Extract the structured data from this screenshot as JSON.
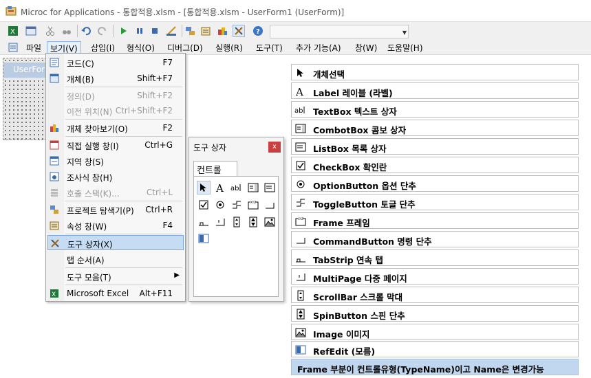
{
  "window": {
    "title": "Microc for Applications - 통합적용.xlsm - [통합적용.xlsm - UserForm1 (UserForm)]"
  },
  "toolbar": {
    "icons": [
      "excel-icon",
      "insert-userform-icon",
      "cut-icon",
      "find-icon",
      "undo-icon",
      "redo-icon",
      "run-icon",
      "break-icon",
      "reset-icon",
      "design-mode-icon",
      "project-explorer-icon",
      "properties-icon",
      "object-browser-icon",
      "toolbox-icon",
      "help-icon"
    ],
    "combo_value": ""
  },
  "menubar": {
    "items": [
      {
        "label": "파일"
      },
      {
        "label": "보기(V)"
      },
      {
        "label": "삽입(I)"
      },
      {
        "label": "형식(O)"
      },
      {
        "label": "디버그(D)"
      },
      {
        "label": "실행(R)"
      },
      {
        "label": "도구(T)"
      },
      {
        "label": "추가 기능(A)"
      },
      {
        "label": "창(W)"
      },
      {
        "label": "도움말(H)"
      }
    ]
  },
  "userform": {
    "title": "UserForm"
  },
  "view_menu": {
    "items": [
      {
        "label": "코드(C)",
        "shortcut": "F7",
        "icon": "code-icon",
        "enabled": true
      },
      {
        "label": "개체(B)",
        "shortcut": "Shift+F7",
        "icon": "object-icon",
        "enabled": true
      },
      {
        "label": "정의(D)",
        "shortcut": "Shift+F2",
        "icon": "",
        "enabled": false
      },
      {
        "label": "이전 위치(N)",
        "shortcut": "Ctrl+Shift+F2",
        "icon": "",
        "enabled": false
      },
      {
        "label": "개체 찾아보기(O)",
        "shortcut": "F2",
        "icon": "object-browser-icon",
        "enabled": true
      },
      {
        "label": "직접 실행 창(I)",
        "shortcut": "Ctrl+G",
        "icon": "immediate-window-icon",
        "enabled": true
      },
      {
        "label": "지역 창(S)",
        "shortcut": "",
        "icon": "locals-window-icon",
        "enabled": true
      },
      {
        "label": "조사식 창(H)",
        "shortcut": "",
        "icon": "watch-window-icon",
        "enabled": true
      },
      {
        "label": "호출 스택(K)...",
        "shortcut": "Ctrl+L",
        "icon": "call-stack-icon",
        "enabled": false
      },
      {
        "label": "프로젝트 탐색기(P)",
        "shortcut": "Ctrl+R",
        "icon": "project-explorer-icon",
        "enabled": true
      },
      {
        "label": "속성 창(W)",
        "shortcut": "F4",
        "icon": "properties-icon",
        "enabled": true
      },
      {
        "label": "도구 상자(X)",
        "shortcut": "",
        "icon": "toolbox-icon",
        "enabled": true
      },
      {
        "label": "탭 순서(A)",
        "shortcut": "",
        "icon": "",
        "enabled": true
      },
      {
        "label": "도구 모음(T)",
        "shortcut": "",
        "icon": "",
        "enabled": true
      },
      {
        "label": "Microsoft Excel",
        "shortcut": "Alt+F11",
        "icon": "excel-icon",
        "enabled": true
      }
    ]
  },
  "toolbox": {
    "title": "도구 상자",
    "close": "x",
    "tab": "컨트롤",
    "tools": [
      "select-objects-icon",
      "label-icon",
      "textbox-icon",
      "combobox-icon",
      "listbox-icon",
      "checkbox-icon",
      "optionbutton-icon",
      "togglebutton-icon",
      "frame-icon",
      "commandbutton-icon",
      "tabstrip-icon",
      "multipage-icon",
      "scrollbar-icon",
      "spinbutton-icon",
      "image-icon",
      "refedit-icon"
    ]
  },
  "control_list": [
    {
      "icon": "select-objects-icon",
      "text": "개체선택"
    },
    {
      "icon": "label-icon",
      "text": "Label 레이블 (라벨)"
    },
    {
      "icon": "textbox-icon",
      "text": "TextBox 텍스트 상자"
    },
    {
      "icon": "combobox-icon",
      "text": "CombotBox 콤보 상자"
    },
    {
      "icon": "listbox-icon",
      "text": "ListBox 목록 상자"
    },
    {
      "icon": "checkbox-icon",
      "text": "CheckBox 확인란"
    },
    {
      "icon": "optionbutton-icon",
      "text": "OptionButton 옵션 단추"
    },
    {
      "icon": "togglebutton-icon",
      "text": "ToggleButton 토글 단추"
    },
    {
      "icon": "frame-icon",
      "text": "Frame 프레임"
    },
    {
      "icon": "commandbutton-icon",
      "text": "CommandButton 명령 단추"
    },
    {
      "icon": "tabstrip-icon",
      "text": "TabStrip 연속 탭"
    },
    {
      "icon": "multipage-icon",
      "text": "MultiPage 다중 페이지"
    },
    {
      "icon": "scrollbar-icon",
      "text": "ScrollBar 스크롤 막대"
    },
    {
      "icon": "spinbutton-icon",
      "text": "SpinButton 스핀 단추"
    },
    {
      "icon": "image-icon",
      "text": "Image 이미지"
    },
    {
      "icon": "refedit-icon",
      "text": "RefEdit (모름)"
    }
  ],
  "footer_note": "Frame 부분이 컨트롤유형(TypeName)이고 Name은 변경가능",
  "colors": {
    "accent_highlight": "#c5dcf3",
    "footer_bg": "#c0d7ef",
    "close_button": "#c84040"
  }
}
